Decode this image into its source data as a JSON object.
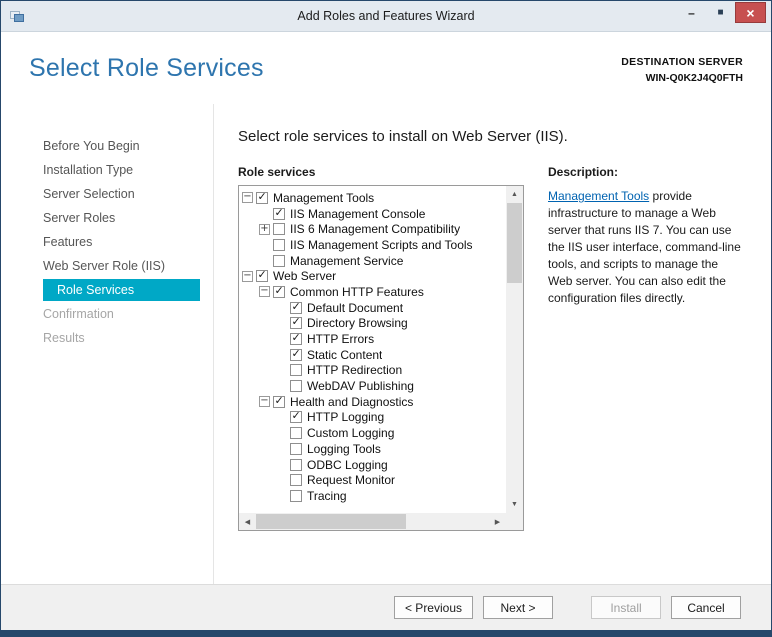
{
  "window": {
    "title": "Add Roles and Features Wizard"
  },
  "header": {
    "title": "Select Role Services",
    "destination_label": "DESTINATION SERVER",
    "destination_server": "WIN-Q0K2J4Q0FTH"
  },
  "sidebar": {
    "items": [
      {
        "label": "Before You Begin",
        "state": "normal"
      },
      {
        "label": "Installation Type",
        "state": "normal"
      },
      {
        "label": "Server Selection",
        "state": "normal"
      },
      {
        "label": "Server Roles",
        "state": "normal"
      },
      {
        "label": "Features",
        "state": "normal"
      },
      {
        "label": "Web Server Role (IIS)",
        "state": "normal"
      },
      {
        "label": "Role Services",
        "state": "selected"
      },
      {
        "label": "Confirmation",
        "state": "disabled"
      },
      {
        "label": "Results",
        "state": "disabled"
      }
    ]
  },
  "main": {
    "heading": "Select role services to install on Web Server (IIS).",
    "tree_label": "Role services",
    "tree": [
      {
        "label": "Management Tools",
        "level": 0,
        "checked": true,
        "expander": "minus"
      },
      {
        "label": "IIS Management Console",
        "level": 1,
        "checked": true,
        "expander": "none"
      },
      {
        "label": "IIS 6 Management Compatibility",
        "level": 1,
        "checked": false,
        "expander": "plus"
      },
      {
        "label": "IIS Management Scripts and Tools",
        "level": 1,
        "checked": false,
        "expander": "none"
      },
      {
        "label": "Management Service",
        "level": 1,
        "checked": false,
        "expander": "none"
      },
      {
        "label": "Web Server",
        "level": 0,
        "checked": true,
        "expander": "minus"
      },
      {
        "label": "Common HTTP Features",
        "level": 1,
        "checked": true,
        "expander": "minus"
      },
      {
        "label": "Default Document",
        "level": 2,
        "checked": true,
        "expander": "none"
      },
      {
        "label": "Directory Browsing",
        "level": 2,
        "checked": true,
        "expander": "none"
      },
      {
        "label": "HTTP Errors",
        "level": 2,
        "checked": true,
        "expander": "none"
      },
      {
        "label": "Static Content",
        "level": 2,
        "checked": true,
        "expander": "none"
      },
      {
        "label": "HTTP Redirection",
        "level": 2,
        "checked": false,
        "expander": "none"
      },
      {
        "label": "WebDAV Publishing",
        "level": 2,
        "checked": false,
        "expander": "none"
      },
      {
        "label": "Health and Diagnostics",
        "level": 1,
        "checked": true,
        "expander": "minus"
      },
      {
        "label": "HTTP Logging",
        "level": 2,
        "checked": true,
        "expander": "none"
      },
      {
        "label": "Custom Logging",
        "level": 2,
        "checked": false,
        "expander": "none"
      },
      {
        "label": "Logging Tools",
        "level": 2,
        "checked": false,
        "expander": "none"
      },
      {
        "label": "ODBC Logging",
        "level": 2,
        "checked": false,
        "expander": "none"
      },
      {
        "label": "Request Monitor",
        "level": 2,
        "checked": false,
        "expander": "none"
      },
      {
        "label": "Tracing",
        "level": 2,
        "checked": false,
        "expander": "none"
      }
    ]
  },
  "description": {
    "label": "Description:",
    "link_text": "Management Tools",
    "text_after": " provide infrastructure to manage a Web server that runs IIS 7. You can use the IIS user interface, command-line tools, and scripts to manage the Web server. You can also edit the configuration files directly."
  },
  "footer": {
    "buttons": [
      {
        "label": "< Previous",
        "enabled": true
      },
      {
        "label": "Next >",
        "enabled": true
      },
      {
        "label": "Install",
        "enabled": false
      },
      {
        "label": "Cancel",
        "enabled": true
      }
    ]
  },
  "icons": {
    "minimize": "–",
    "maximize": "■",
    "close": "×",
    "collapse": "−",
    "expand": "+",
    "scroll_up": "▲",
    "scroll_down": "▼",
    "scroll_left": "◀",
    "scroll_right": "▶"
  },
  "colors": {
    "accent": "#2e75ae",
    "nav_selected_bg": "#00a8c6",
    "nav_selected_text": "#ffffff",
    "link": "#0063b1",
    "window_border": "#26486b",
    "titlebar_bg": "#e4eaf0",
    "close_button_bg": "#c75050",
    "footer_bg": "#f0f0f0"
  }
}
